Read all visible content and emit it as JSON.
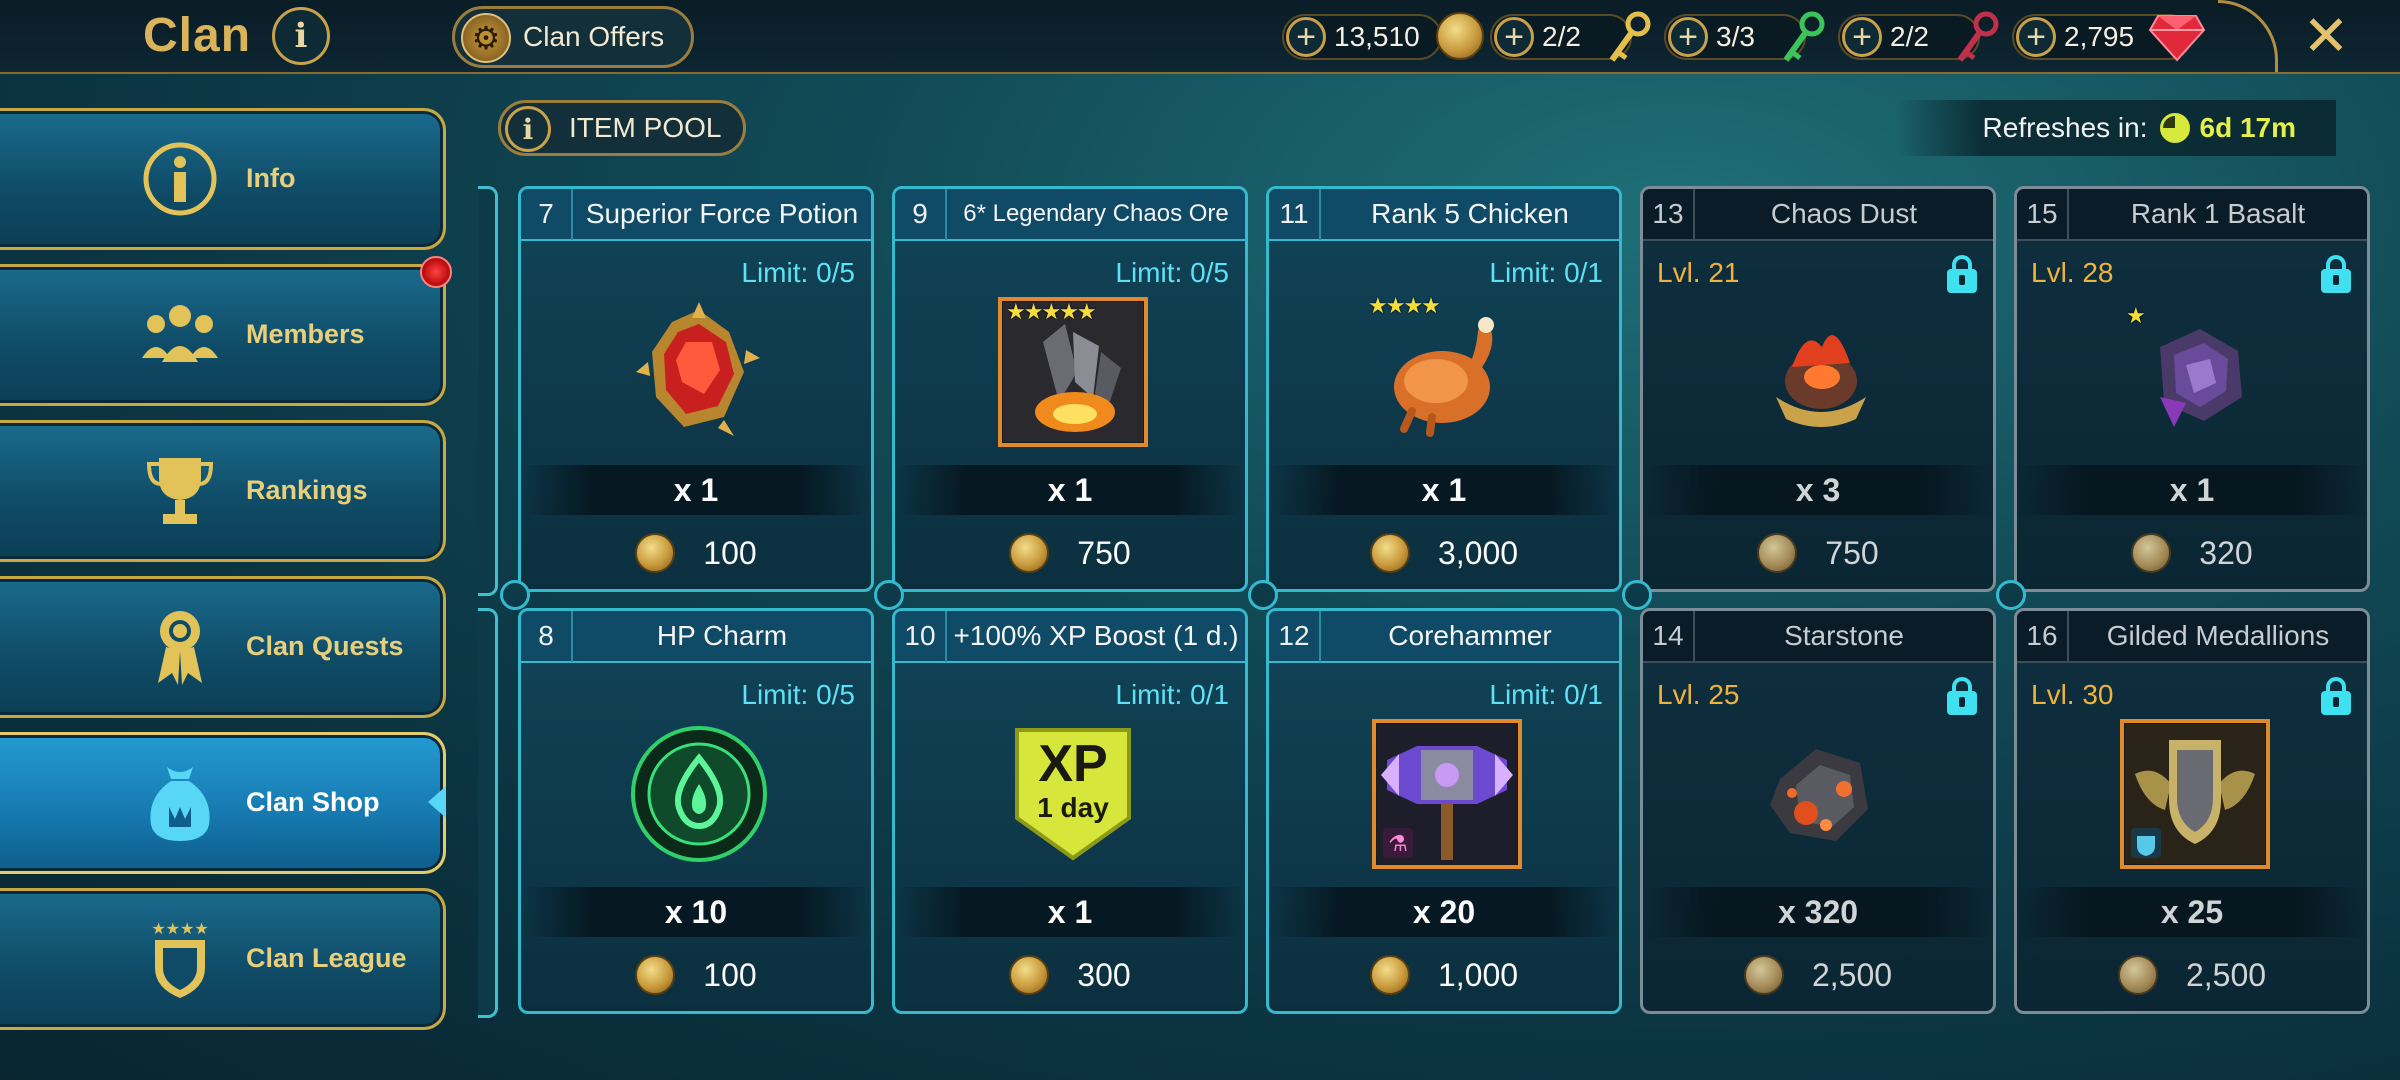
{
  "header": {
    "title": "Clan",
    "info_glyph": "i",
    "clan_offers_label": "Clan Offers",
    "close_glyph": "✕"
  },
  "resources": [
    {
      "name": "silver",
      "value": "13,510",
      "icon": "silver-coin-icon"
    },
    {
      "name": "gold-key",
      "value": "2/2",
      "icon": "gold-key-icon"
    },
    {
      "name": "green-key",
      "value": "3/3",
      "icon": "green-key-icon"
    },
    {
      "name": "red-key",
      "value": "2/2",
      "icon": "red-key-icon"
    },
    {
      "name": "gems",
      "value": "2,795",
      "icon": "gem-icon"
    }
  ],
  "sidebar": {
    "items": [
      {
        "label": "Info",
        "icon": "info-icon"
      },
      {
        "label": "Members",
        "icon": "members-icon"
      },
      {
        "label": "Rankings",
        "icon": "trophy-icon"
      },
      {
        "label": "Clan Quests",
        "icon": "medal-icon"
      },
      {
        "label": "Clan Shop",
        "icon": "shop-bag-icon",
        "active": true
      },
      {
        "label": "Clan League",
        "icon": "shield-stars-icon"
      }
    ]
  },
  "item_pool": {
    "label": "ITEM POOL",
    "refresh_label": "Refreshes in:",
    "refresh_value": "6d 17m"
  },
  "cards": [
    {
      "num": "7",
      "name": "Superior Force Potion",
      "limit": "Limit: 0/5",
      "qty": "x 1",
      "price": "100",
      "icon": "force-potion-icon"
    },
    {
      "num": "9",
      "name": "6* Legendary Chaos Ore",
      "limit": "Limit: 0/5",
      "qty": "x 1",
      "price": "750",
      "icon": "chaos-ore-icon",
      "stars": "★★★★★"
    },
    {
      "num": "11",
      "name": "Rank 5 Chicken",
      "limit": "Limit: 0/1",
      "qty": "x 1",
      "price": "3,000",
      "icon": "chicken-icon",
      "stars": "★★★★"
    },
    {
      "num": "13",
      "name": "Chaos Dust",
      "level": "Lvl. 21",
      "locked": true,
      "qty": "x 3",
      "price": "750",
      "icon": "chaos-dust-icon"
    },
    {
      "num": "15",
      "name": "Rank 1 Basalt",
      "level": "Lvl. 28",
      "locked": true,
      "qty": "x 1",
      "price": "320",
      "icon": "basalt-icon",
      "stars": "★"
    },
    {
      "num": "8",
      "name": "HP Charm",
      "limit": "Limit: 0/5",
      "qty": "x 10",
      "price": "100",
      "icon": "hp-charm-icon"
    },
    {
      "num": "10",
      "name": "+100% XP Boost (1 d.)",
      "limit": "Limit: 0/1",
      "qty": "x 1",
      "price": "300",
      "icon": "xp-boost-icon",
      "badge_top": "XP",
      "badge_bottom": "1 day"
    },
    {
      "num": "12",
      "name": "Corehammer",
      "limit": "Limit: 0/1",
      "qty": "x 20",
      "price": "1,000",
      "icon": "corehammer-icon"
    },
    {
      "num": "14",
      "name": "Starstone",
      "level": "Lvl. 25",
      "locked": true,
      "qty": "x 320",
      "price": "2,500",
      "icon": "starstone-icon"
    },
    {
      "num": "16",
      "name": "Gilded Medallions",
      "level": "Lvl. 30",
      "locked": true,
      "qty": "x 25",
      "price": "2,500",
      "icon": "medallion-icon"
    }
  ],
  "colors": {
    "gold": "#d9b45a",
    "cyan": "#35b9cf",
    "limit_text": "#5ee1f5",
    "level_text": "#f0b33a",
    "refresh_value": "#e6f04d"
  }
}
